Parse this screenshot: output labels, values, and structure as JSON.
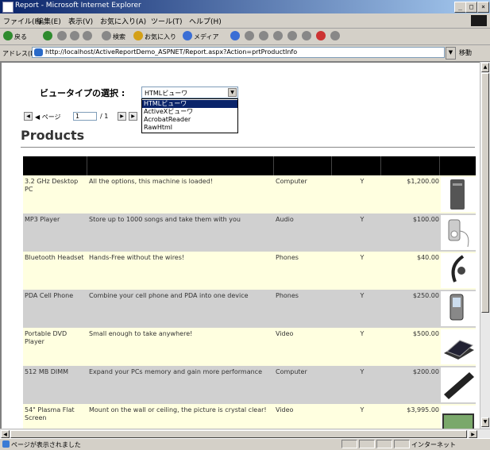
{
  "window": {
    "title": "Report - Microsoft Internet Explorer",
    "controls": [
      "_",
      "□",
      "×"
    ]
  },
  "menubar": [
    "ファイル(F)",
    "編集(E)",
    "表示(V)",
    "お気に入り(A)",
    "ツール(T)",
    "ヘルプ(H)"
  ],
  "toolbar": {
    "back": "戻る",
    "search": "検索",
    "favorites": "お気に入り",
    "media": "メディア"
  },
  "addressbar": {
    "label": "アドレス(D)",
    "url": "http://localhost/ActiveReportDemo_ASPNET/Report.aspx?Action=prtProductInfo",
    "go": "移動"
  },
  "viewer": {
    "label": "ビュータイプの選択 :",
    "selected": "HTMLビューワ",
    "options": [
      "HTMLビューワ",
      "ActiveXビューワ",
      "AcrobatReader",
      "RawHtml"
    ]
  },
  "pager": {
    "prev_label": "◀ ページ",
    "page": "1",
    "total": "/ 1"
  },
  "report": {
    "heading": "Products",
    "rows": [
      {
        "name": "3.2 GHz Desktop PC",
        "description": "All the options, this machine is loaded!",
        "category": "Computer",
        "in_stock": "Y",
        "price": "$1,200.00",
        "image": "desktop-pc-image"
      },
      {
        "name": "MP3 Player",
        "description": "Store up to 1000 songs and take them with you",
        "category": "Audio",
        "in_stock": "Y",
        "price": "$100.00",
        "image": "mp3-player-image"
      },
      {
        "name": "Bluetooth Headset",
        "description": "Hands-Free without the wires!",
        "category": "Phones",
        "in_stock": "Y",
        "price": "$40.00",
        "image": "headset-image"
      },
      {
        "name": "PDA Cell Phone",
        "description": "Combine your cell phone and PDA into one device",
        "category": "Phones",
        "in_stock": "Y",
        "price": "$250.00",
        "image": "pda-phone-image"
      },
      {
        "name": "Portable DVD Player",
        "description": "Small enough to take anywhere!",
        "category": "Video",
        "in_stock": "Y",
        "price": "$500.00",
        "image": "dvd-player-image"
      },
      {
        "name": "512 MB DIMM",
        "description": "Expand your PCs memory and gain more performance",
        "category": "Computer",
        "in_stock": "Y",
        "price": "$200.00",
        "image": "dimm-image"
      },
      {
        "name": "54\" Plasma Flat Screen",
        "description": "Mount on the wall or ceiling, the picture is crystal clear!",
        "category": "Video",
        "in_stock": "Y",
        "price": "$3,995.00",
        "image": "plasma-screen-image"
      }
    ]
  },
  "status": {
    "text": "ページが表示されました",
    "zone": "インターネット"
  },
  "colors": {
    "row_odd": "#ffffe0",
    "row_even": "#d0d0d0",
    "header": "#000000",
    "titlebar": "#0a246a",
    "selection": "#0a246a"
  }
}
